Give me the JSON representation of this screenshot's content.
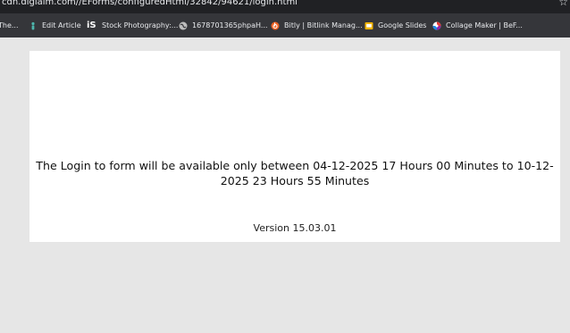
{
  "browser": {
    "url": "cdn.digialm.com//EForms/configuredHtml/32842/94621/login.html",
    "star_icon": "star-outline-icon",
    "bookmarks": [
      {
        "label": "The...",
        "icon": "none"
      },
      {
        "label": "Edit Article",
        "icon": "wiki-person-icon"
      },
      {
        "label": "Stock Photography:...",
        "icon": "istock-icon"
      },
      {
        "label": "1678701365phpaH...",
        "icon": "globe-icon"
      },
      {
        "label": "Bitly | Bitlink Manag...",
        "icon": "bitly-icon"
      },
      {
        "label": "Google Slides",
        "icon": "google-slides-icon"
      },
      {
        "label": "Collage Maker | BeF...",
        "icon": "befunky-icon"
      }
    ]
  },
  "page": {
    "message": "The Login to form will be available only between 04-12-2025 17 Hours 00 Minutes to 10-12-2025 23 Hours 55 Minutes",
    "version": "Version 15.03.01"
  },
  "colors": {
    "page_bg": "#e6e6e6",
    "card_bg": "#ffffff",
    "toolbar_bg": "#202124",
    "bookmarks_bg": "#35363a"
  }
}
